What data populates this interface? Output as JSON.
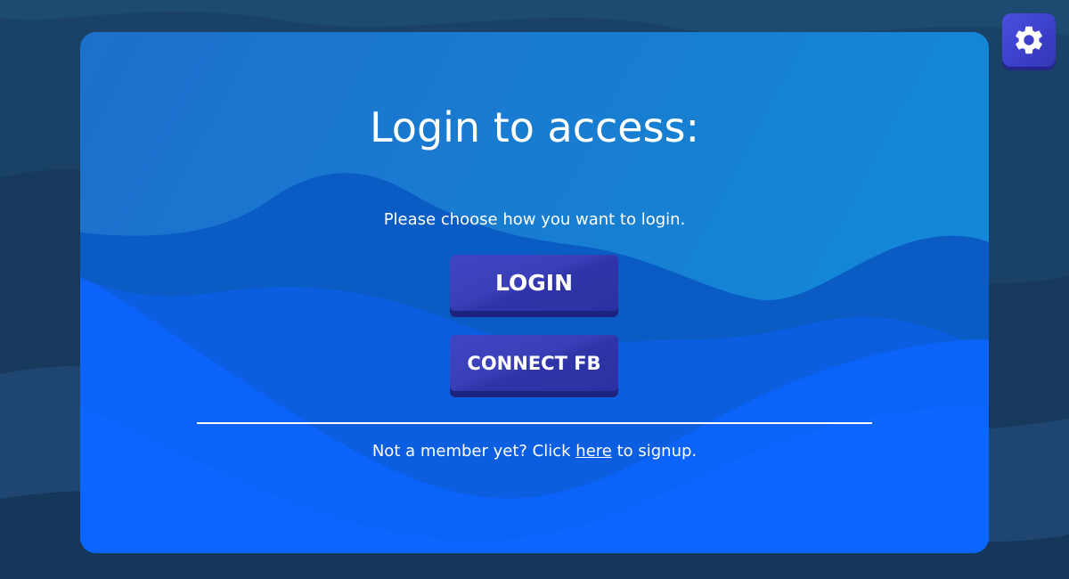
{
  "page": {
    "title": "Login to access:",
    "subtitle": "Please choose how you want to login."
  },
  "buttons": {
    "login_label": "LOGIN",
    "connect_fb_label": "CONNECT FB"
  },
  "footer": {
    "text_before": "Not a member yet? Click ",
    "link_text": "here",
    "text_after": " to signup."
  },
  "icons": {
    "settings": "gear-icon"
  },
  "colors": {
    "background": "#1a3f63",
    "panel_top": "#1c7fd3",
    "panel_bottom": "#0b63ff",
    "button": "#3a3fb8",
    "settings_button": "#4348d6",
    "text": "#ffffff"
  }
}
